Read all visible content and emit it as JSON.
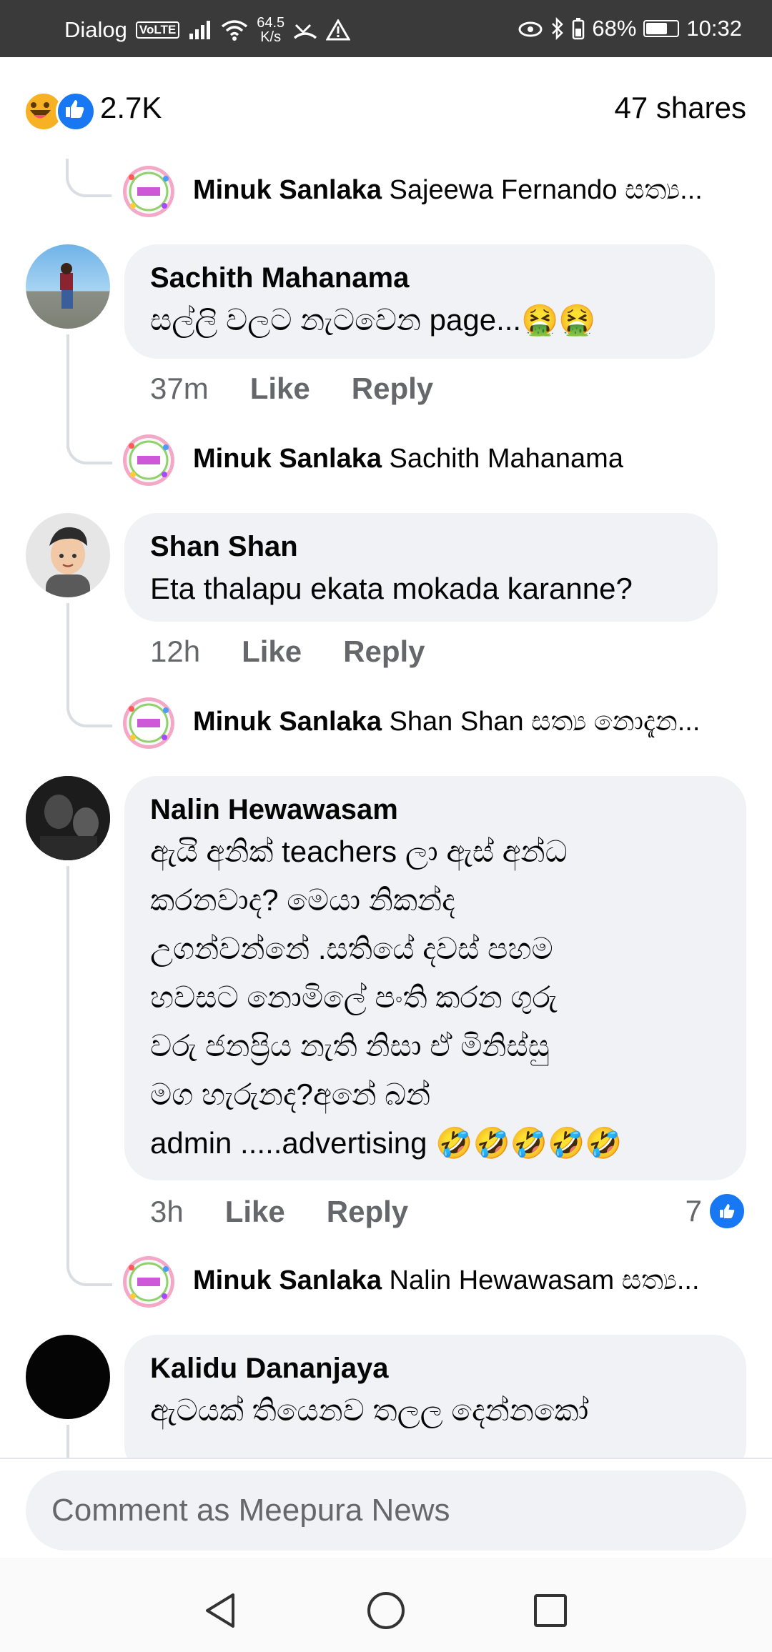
{
  "status_bar": {
    "carrier": "Dialog",
    "volte": "VoLTE",
    "speed_top": "64.5",
    "speed_bottom": "K/s",
    "battery": "68%",
    "time": "10:32",
    "battery_level": 0.68
  },
  "reactions": {
    "count": "2.7K",
    "shares": "47 shares"
  },
  "comments": [
    {
      "reply": {
        "author": "Minuk Sanlaka",
        "text": "Sajeewa Fernando සත්‍ය..."
      }
    },
    {
      "author": "Sachith Mahanama",
      "text": "සල්ලි වලට නැටවෙන page...🤮🤮",
      "time": "37m",
      "like": "Like",
      "reply_label": "Reply",
      "reply": {
        "author": "Minuk Sanlaka",
        "text": "Sachith Mahanama"
      }
    },
    {
      "author": "Shan Shan",
      "text": "Eta thalapu ekata mokada karanne?",
      "time": "12h",
      "like": "Like",
      "reply_label": "Reply",
      "reply": {
        "author": "Minuk Sanlaka",
        "text": "Shan Shan සත්‍ය නොදැන..."
      }
    },
    {
      "author": "Nalin Hewawasam",
      "text_lines": [
        "ඇයි අනික් teachers  ලා ඇස් අන්ධ",
        "කරනවාද? මෙයා නිකන්ද",
        "උගන්වන්නේ .සතියේ දවස් පහම",
        "හවසට නොමිලේ පංති කරන ගුරු",
        "වරු ජනප්‍රිය නැති නිසා ඒ මිනිස්සු",
        "මග හැරුනද?අනේ බන්",
        "admin .....advertising 🤣🤣🤣🤣🤣"
      ],
      "time": "3h",
      "like": "Like",
      "reply_label": "Reply",
      "like_count": "7",
      "reply": {
        "author": "Minuk Sanlaka",
        "text": "Nalin Hewawasam සත්‍ය..."
      }
    },
    {
      "author": "Kalidu Dananjaya",
      "text": "ඇටයක් තියෙනව තලල දෙන්නකෝ"
    }
  ],
  "composer": {
    "placeholder": "Comment as Meepura News"
  },
  "colors": {
    "accent": "#1877f2",
    "bubble": "#f0f2f5",
    "meta": "#65676b"
  }
}
